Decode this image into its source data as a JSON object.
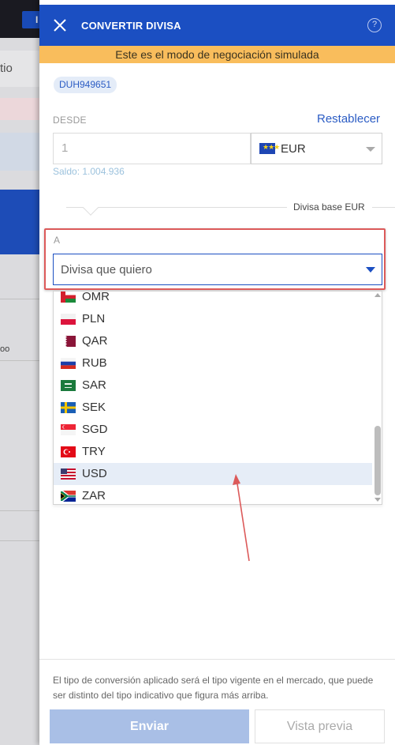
{
  "background": {
    "top_button_label": "I",
    "row_text": "tio",
    "row_small_text": "oo"
  },
  "panel": {
    "title": "CONVERTIR DIVISA",
    "help_icon": "?",
    "banner": "Este es el modo de negociación simulada",
    "account_id": "DUH949651",
    "from": {
      "label": "DESDE",
      "reset_label": "Restablecer",
      "amount_placeholder": "1",
      "currency": "EUR",
      "balance": "Saldo: 1.004.936"
    },
    "base_currency_label": "Divisa base EUR",
    "to": {
      "label": "A",
      "placeholder": "Divisa que quiero"
    },
    "dropdown_options": [
      {
        "code": "OMR",
        "flag": "oman-flag-icon"
      },
      {
        "code": "PLN",
        "flag": "poland-flag-icon"
      },
      {
        "code": "QAR",
        "flag": "qatar-flag-icon"
      },
      {
        "code": "RUB",
        "flag": "russia-flag-icon"
      },
      {
        "code": "SAR",
        "flag": "saudi-arabia-flag-icon"
      },
      {
        "code": "SEK",
        "flag": "sweden-flag-icon"
      },
      {
        "code": "SGD",
        "flag": "singapore-flag-icon"
      },
      {
        "code": "TRY",
        "flag": "turkey-flag-icon"
      },
      {
        "code": "USD",
        "flag": "usa-flag-icon",
        "selected": true
      },
      {
        "code": "ZAR",
        "flag": "south-africa-flag-icon"
      }
    ],
    "note": "El tipo de conversión aplicado será el tipo vigente en el mercado, que puede ser distinto del tipo indicativo que figura más arriba.",
    "send_label": "Enviar",
    "preview_label": "Vista previa"
  },
  "colors": {
    "header": "#1b4fc2",
    "banner": "#f9bd5c",
    "annotation": "#dc5a5a",
    "link": "#2b5cc4"
  }
}
